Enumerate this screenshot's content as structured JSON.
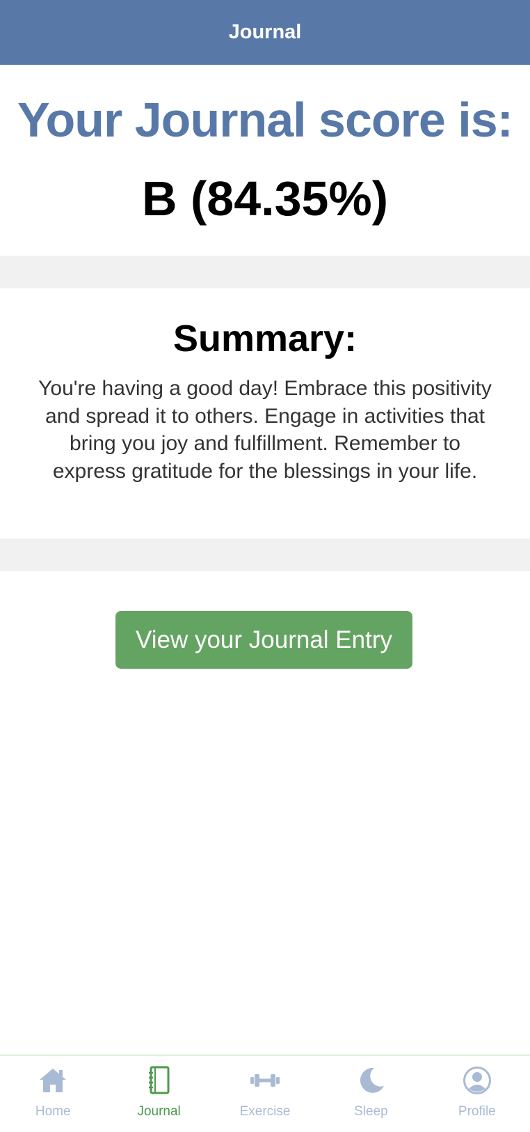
{
  "header": {
    "title": "Journal"
  },
  "score": {
    "heading": "Your Journal score is:",
    "value": "B (84.35%)"
  },
  "summary": {
    "heading": "Summary:",
    "text": "You're having a good day! Embrace this positivity and spread it to others. Engage in activities that bring you joy and fulfillment. Remember to express gratitude for the blessings in your life."
  },
  "actions": {
    "view_entry_label": "View your Journal Entry"
  },
  "tabbar": {
    "items": [
      {
        "label": "Home",
        "icon": "home-icon",
        "active": false
      },
      {
        "label": "Journal",
        "icon": "journal-icon",
        "active": true
      },
      {
        "label": "Exercise",
        "icon": "dumbbell-icon",
        "active": false
      },
      {
        "label": "Sleep",
        "icon": "moon-icon",
        "active": false
      },
      {
        "label": "Profile",
        "icon": "profile-icon",
        "active": false
      }
    ]
  },
  "colors": {
    "brand_blue": "#5878a8",
    "accent_green": "#64a462",
    "active_tab_green": "#4c9a4c",
    "inactive_tab": "#a9bbd4",
    "band_gray": "#f1f1f1"
  }
}
